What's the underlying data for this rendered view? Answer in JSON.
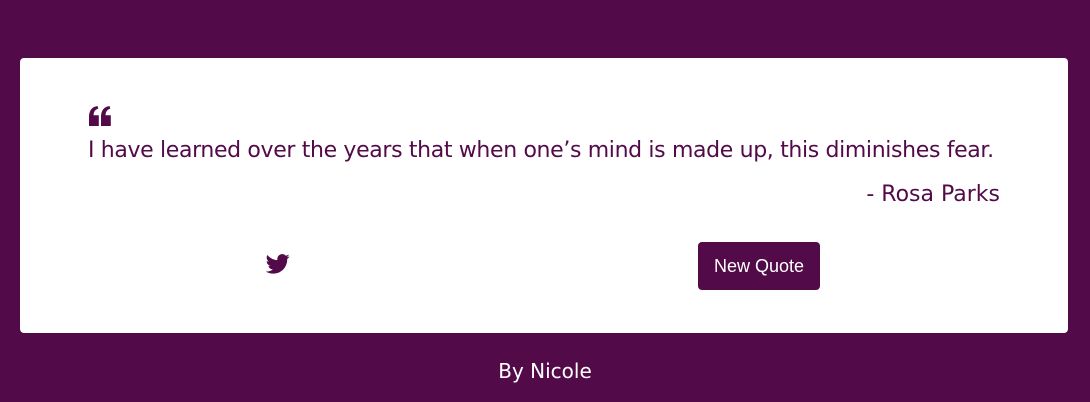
{
  "quote": {
    "icon": "quote-left-icon",
    "text": "I have learned over the years that when one’s mind is made up, this diminishes fear.",
    "author": "- Rosa Parks"
  },
  "actions": {
    "tweet_icon": "twitter-icon",
    "new_quote_label": "New Quote"
  },
  "footer": {
    "credit": "By Nicole"
  },
  "colors": {
    "background": "#520a48",
    "card": "#ffffff",
    "text": "#520a48",
    "button": "#520a48",
    "button_text": "#ffffff"
  }
}
